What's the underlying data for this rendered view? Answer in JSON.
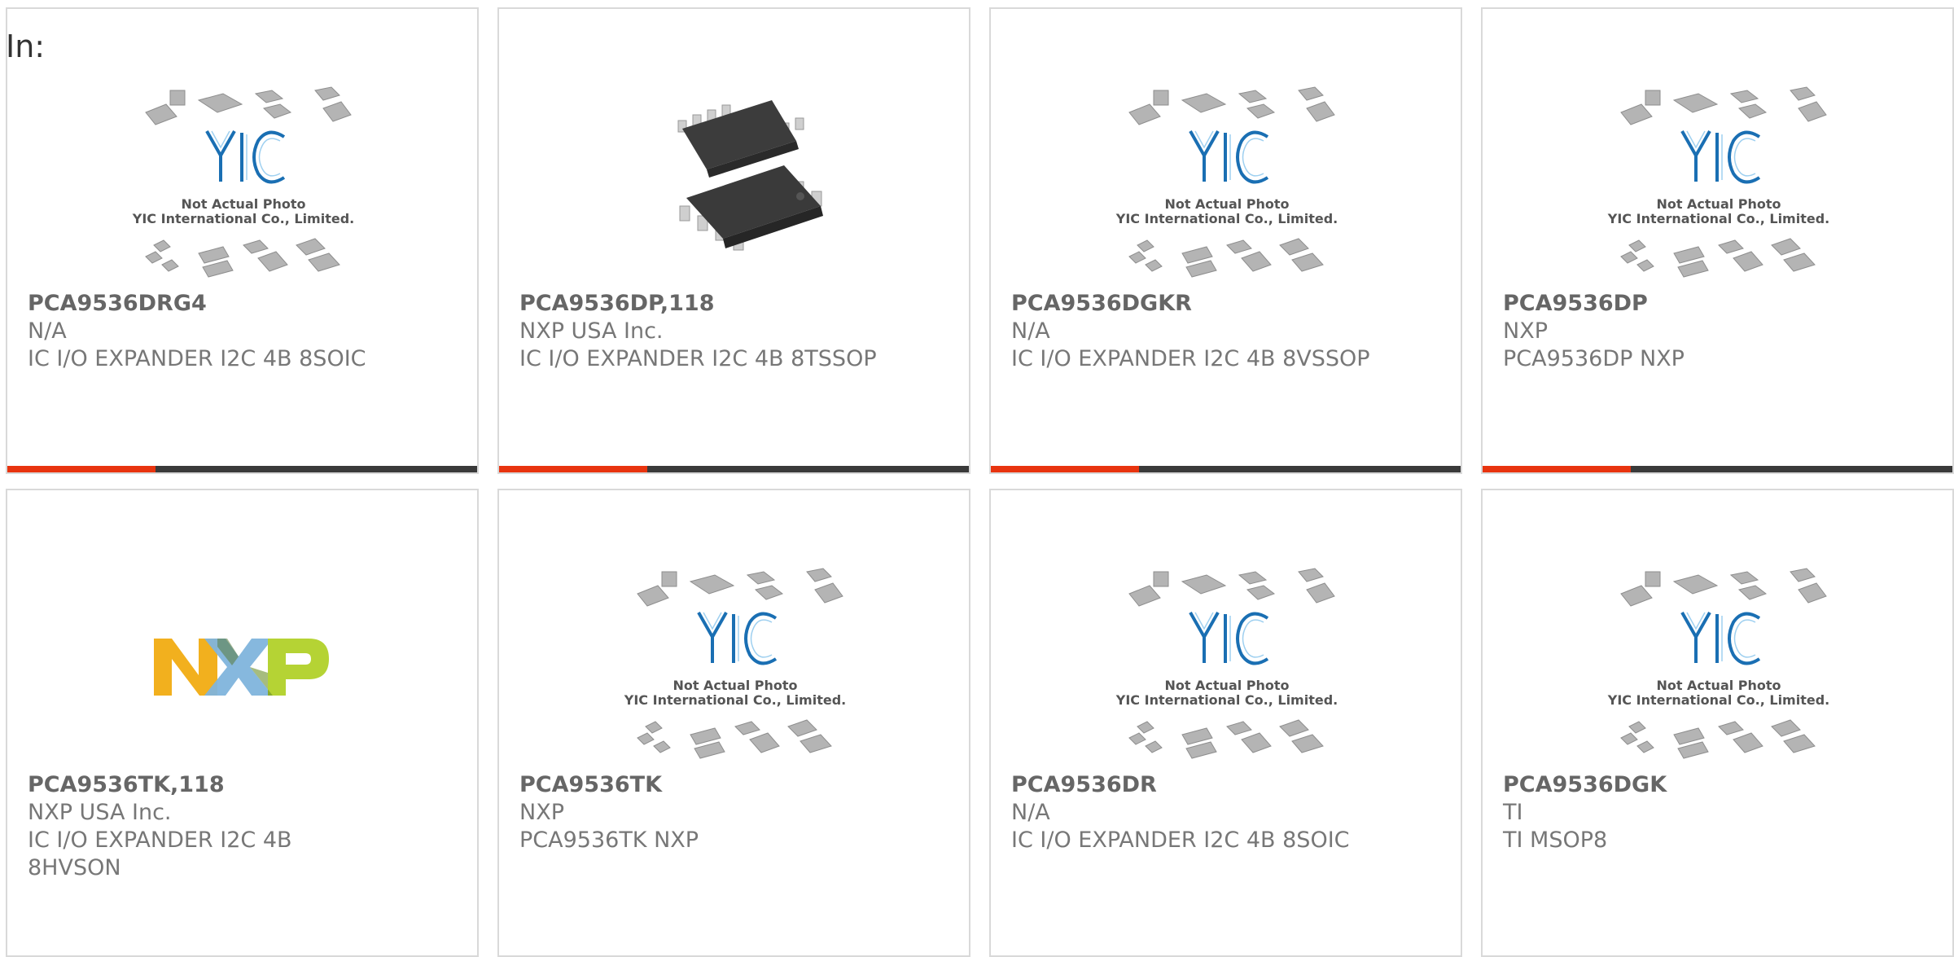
{
  "header": {
    "prefix_label": "In:"
  },
  "colors": {
    "accent": "#e8340f",
    "bar_dark": "#3a3a3a",
    "card_border": "#d9d9d9",
    "text_main": "#666666",
    "yic_blue": "#1a6fb3",
    "nxp_yellow": "#f2b01e",
    "nxp_blue": "#7fb4dc",
    "nxp_green": "#b5d334"
  },
  "placeholder": {
    "brand": "YIC",
    "line1": "Not Actual Photo",
    "line2": "YIC International Co., Limited."
  },
  "products": [
    {
      "part": "PCA9536DRG4",
      "manufacturer": "N/A",
      "description": "IC I/O EXPANDER I2C 4B 8SOIC",
      "image": "yic-placeholder"
    },
    {
      "part": "PCA9536DP,118",
      "manufacturer": "NXP USA Inc.",
      "description": "IC I/O EXPANDER I2C 4B 8TSSOP",
      "image": "tssop-chip-photo"
    },
    {
      "part": "PCA9536DGKR",
      "manufacturer": "N/A",
      "description": "IC I/O EXPANDER I2C 4B 8VSSOP",
      "image": "yic-placeholder"
    },
    {
      "part": "PCA9536DP",
      "manufacturer": "NXP",
      "description": "PCA9536DP NXP",
      "image": "yic-placeholder"
    },
    {
      "part": "PCA9536TK,118",
      "manufacturer": "NXP USA Inc.",
      "description": "IC I/O EXPANDER I2C 4B 8HVSON",
      "image": "nxp-logo"
    },
    {
      "part": "PCA9536TK",
      "manufacturer": "NXP",
      "description": "PCA9536TK NXP",
      "image": "yic-placeholder"
    },
    {
      "part": "PCA9536DR",
      "manufacturer": "N/A",
      "description": "IC I/O EXPANDER I2C 4B 8SOIC",
      "image": "yic-placeholder"
    },
    {
      "part": "PCA9536DGK",
      "manufacturer": "TI",
      "description": "TI MSOP8",
      "image": "yic-placeholder"
    }
  ]
}
